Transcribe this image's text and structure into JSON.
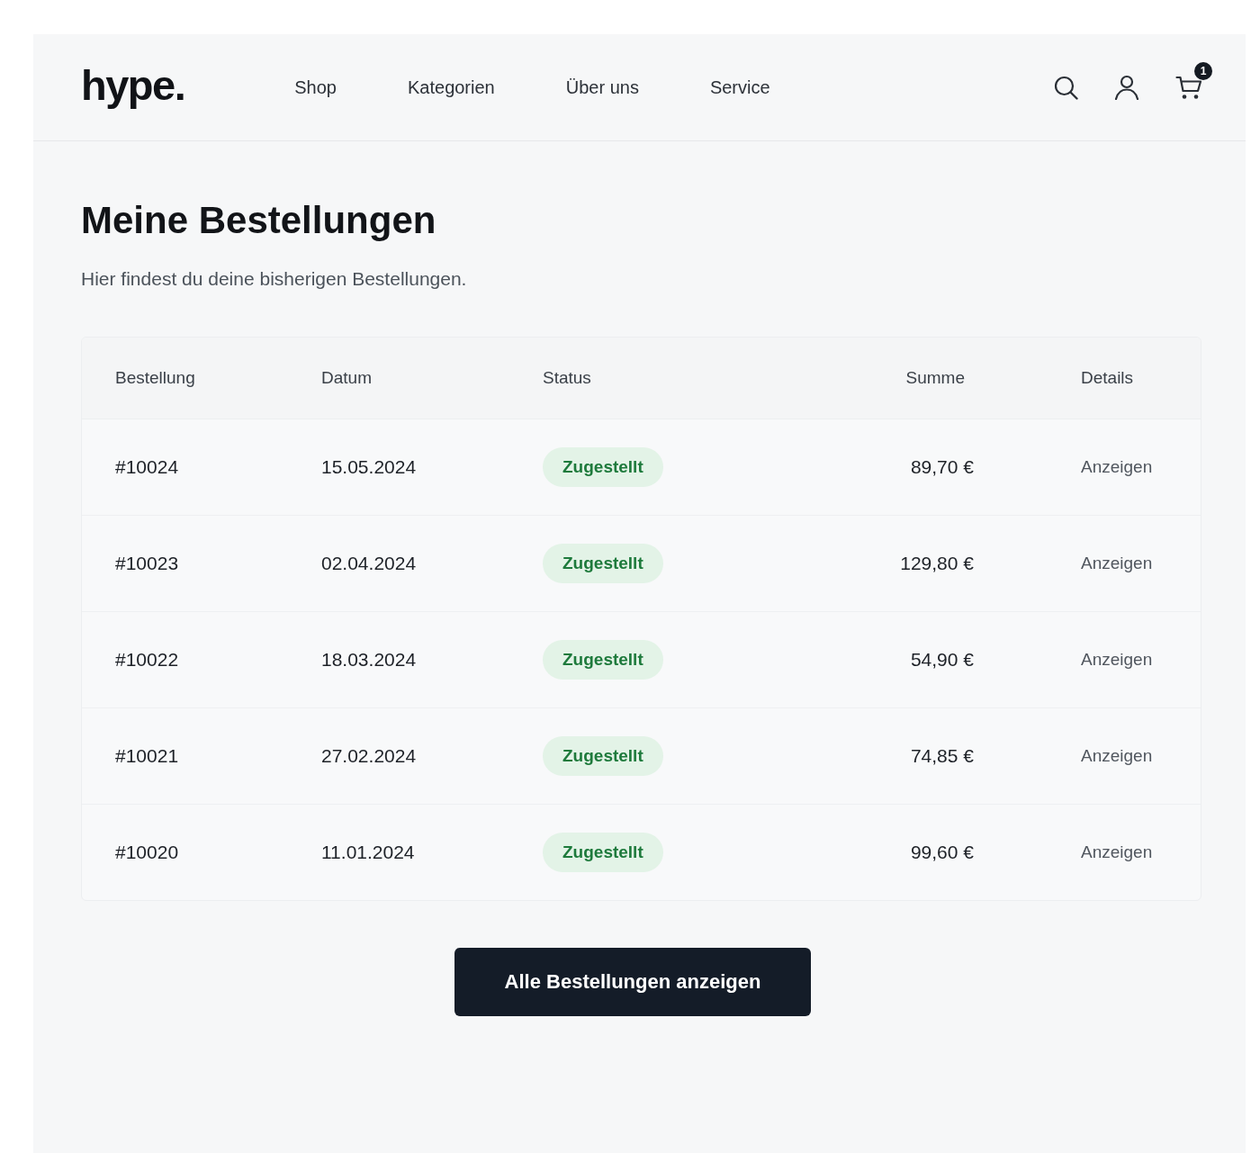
{
  "header": {
    "logo": "hype.",
    "nav": [
      {
        "label": "Shop"
      },
      {
        "label": "Kategorien"
      },
      {
        "label": "Über uns"
      },
      {
        "label": "Service"
      }
    ],
    "cart_badge": "1"
  },
  "page": {
    "title": "Meine Bestellungen",
    "subtitle": "Hier findest du deine bisherigen Bestellungen."
  },
  "table": {
    "columns": [
      "Bestellung",
      "Datum",
      "Status",
      "Summe",
      "Details"
    ],
    "rows": [
      {
        "order": "#10024",
        "date": "15.05.2024",
        "status": "Zugestellt",
        "total": "89,70 €",
        "details": "Anzeigen"
      },
      {
        "order": "#10023",
        "date": "02.04.2024",
        "status": "Zugestellt",
        "total": "129,80 €",
        "details": "Anzeigen"
      },
      {
        "order": "#10022",
        "date": "18.03.2024",
        "status": "Zugestellt",
        "total": "54,90 €",
        "details": "Anzeigen"
      },
      {
        "order": "#10021",
        "date": "27.02.2024",
        "status": "Zugestellt",
        "total": "74,85 €",
        "details": "Anzeigen"
      },
      {
        "order": "#10020",
        "date": "11.01.2024",
        "status": "Zugestellt",
        "total": "99,60 €",
        "details": "Anzeigen"
      }
    ]
  },
  "button": {
    "label": "Alle Bestellungen anzeigen"
  }
}
